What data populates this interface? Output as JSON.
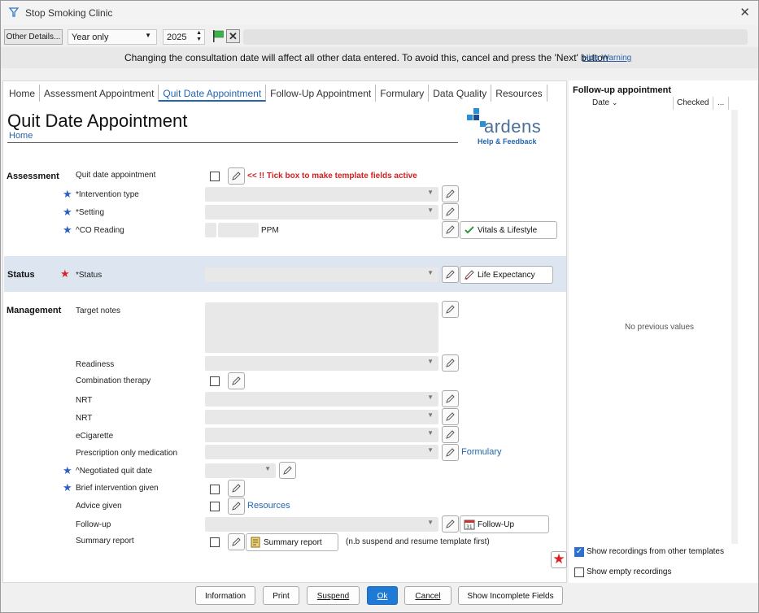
{
  "window": {
    "title": "Stop Smoking Clinic"
  },
  "toolbar": {
    "other_details": "Other Details...",
    "period": "Year only",
    "year": "2025"
  },
  "warning": {
    "text": "Changing the consultation date will affect all other data entered. To avoid this, cancel and press the 'Next' button",
    "hide": "Hide Warning"
  },
  "tabs": [
    "Home",
    "Assessment Appointment",
    "Quit Date Appointment",
    "Follow-Up Appointment",
    "Formulary",
    "Data Quality",
    "Resources"
  ],
  "page": {
    "title": "Quit Date Appointment",
    "home_link": "Home"
  },
  "logo": {
    "name": "ardens",
    "sub": "Help & Feedback"
  },
  "sections": {
    "assessment": "Assessment",
    "status": "Status",
    "management": "Management"
  },
  "fields": {
    "quit_date_appointment": "Quit date appointment",
    "tick_hint": "<< !! Tick box to make template fields active",
    "intervention_type": "*Intervention type",
    "setting": "*Setting",
    "co_reading": "^CO Reading",
    "co_unit": "PPM",
    "status": "*Status",
    "target_notes": "Target notes",
    "readiness": "Readiness",
    "combination_therapy": "Combination therapy",
    "nrt1": "NRT",
    "nrt2": "NRT",
    "ecigarette": "eCigarette",
    "pom": "Prescription only medication",
    "negotiated_quit_date": "^Negotiated quit date",
    "brief_intervention": "Brief intervention given",
    "advice_given": "Advice given",
    "follow_up": "Follow-up",
    "summary_report": "Summary report"
  },
  "buttons": {
    "vitals": "Vitals & Lifestyle",
    "life_expectancy": "Life Expectancy",
    "formulary_link": "Formulary",
    "resources_link": "Resources",
    "follow_up_btn": "Follow-Up",
    "summary_report_btn": "Summary report",
    "summary_note": "(n.b suspend and resume template first)"
  },
  "right_panel": {
    "title": "Follow-up appointment",
    "col_date": "Date",
    "col_checked": "Checked",
    "col_more": "...",
    "empty": "No previous values",
    "show_other": "Show recordings from other templates",
    "show_other_checked": true,
    "show_empty": "Show empty recordings",
    "show_empty_checked": false
  },
  "footer": {
    "information": "Information",
    "print": "Print",
    "suspend": "Suspend",
    "ok": "Ok",
    "cancel": "Cancel",
    "show_incomplete": "Show Incomplete Fields"
  },
  "colors": {
    "accent": "#2266b3",
    "star_blue": "#2b5fc8",
    "star_red": "#e02020",
    "status_band": "#dde6f0",
    "hint_red": "#d21f1f"
  }
}
